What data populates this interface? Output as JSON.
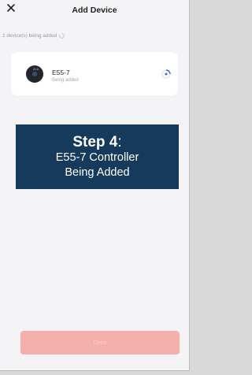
{
  "header": {
    "title": "Add Device",
    "close_icon": "close-icon"
  },
  "progress": {
    "text": "1 device(s) being added"
  },
  "device": {
    "name": "E55-7",
    "status": "Being added",
    "icon": "thermostat-icon",
    "icon_text": "21.5"
  },
  "banner": {
    "step_label": "Step 4",
    "step_suffix": ":",
    "line1": "E55-7 Controller",
    "line2": "Being Added"
  },
  "footer": {
    "done_label": "Done"
  },
  "colors": {
    "banner_bg": "#163a5c",
    "button_bg": "#f3b0ac",
    "spinner": "#3a6fd8"
  }
}
